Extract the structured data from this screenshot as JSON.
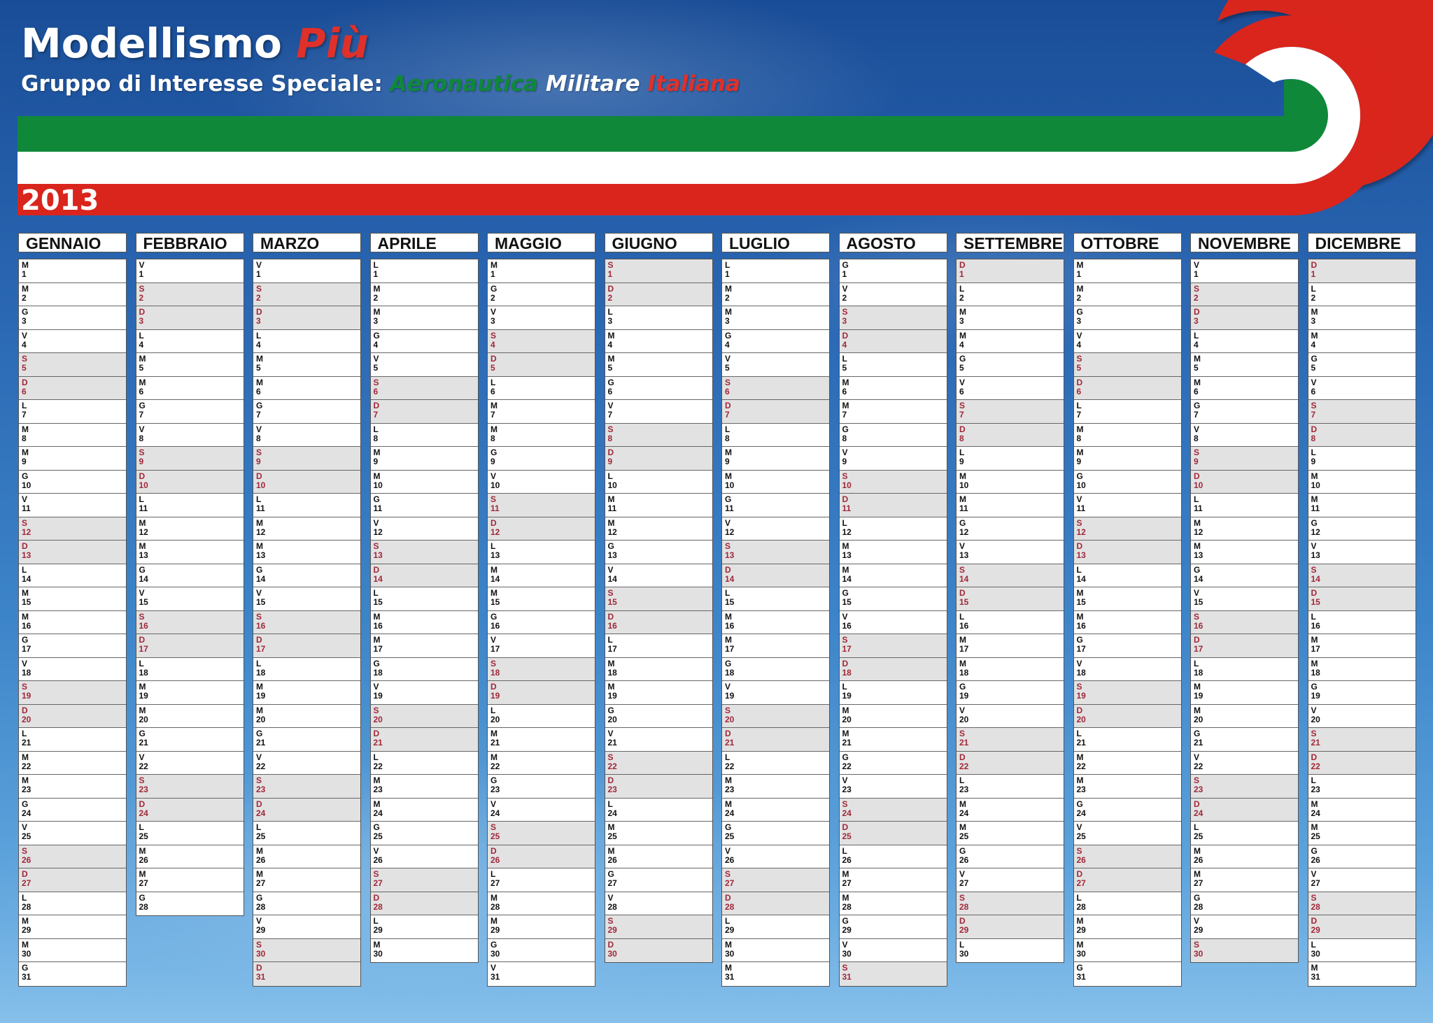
{
  "header": {
    "title_main": "Modellismo ",
    "title_accent": "Più",
    "subtitle_prefix": "Gruppo di Interesse Speciale: ",
    "subtitle_green": "Aeronautica",
    "subtitle_white": "Militare",
    "subtitle_red": "Italiana",
    "year": "2013"
  },
  "colors": {
    "green": "#10883a",
    "white": "#ffffff",
    "red": "#d9251c",
    "weekend_fill": "#e2e2e2",
    "weekend_text": "#a0283a"
  },
  "calendar": {
    "weekday_letters": [
      "D",
      "L",
      "M",
      "M",
      "G",
      "V",
      "S"
    ],
    "weekend_days": [
      0,
      6
    ],
    "months": [
      {
        "name": "GENNAIO",
        "days": 31,
        "first_weekday": 2
      },
      {
        "name": "FEBBRAIO",
        "days": 28,
        "first_weekday": 5
      },
      {
        "name": "MARZO",
        "days": 31,
        "first_weekday": 5
      },
      {
        "name": "APRILE",
        "days": 30,
        "first_weekday": 1
      },
      {
        "name": "MAGGIO",
        "days": 31,
        "first_weekday": 3
      },
      {
        "name": "GIUGNO",
        "days": 30,
        "first_weekday": 6
      },
      {
        "name": "LUGLIO",
        "days": 31,
        "first_weekday": 1
      },
      {
        "name": "AGOSTO",
        "days": 31,
        "first_weekday": 4
      },
      {
        "name": "SETTEMBRE",
        "days": 30,
        "first_weekday": 0
      },
      {
        "name": "OTTOBRE",
        "days": 31,
        "first_weekday": 2
      },
      {
        "name": "NOVEMBRE",
        "days": 30,
        "first_weekday": 5
      },
      {
        "name": "DICEMBRE",
        "days": 31,
        "first_weekday": 0
      }
    ]
  }
}
